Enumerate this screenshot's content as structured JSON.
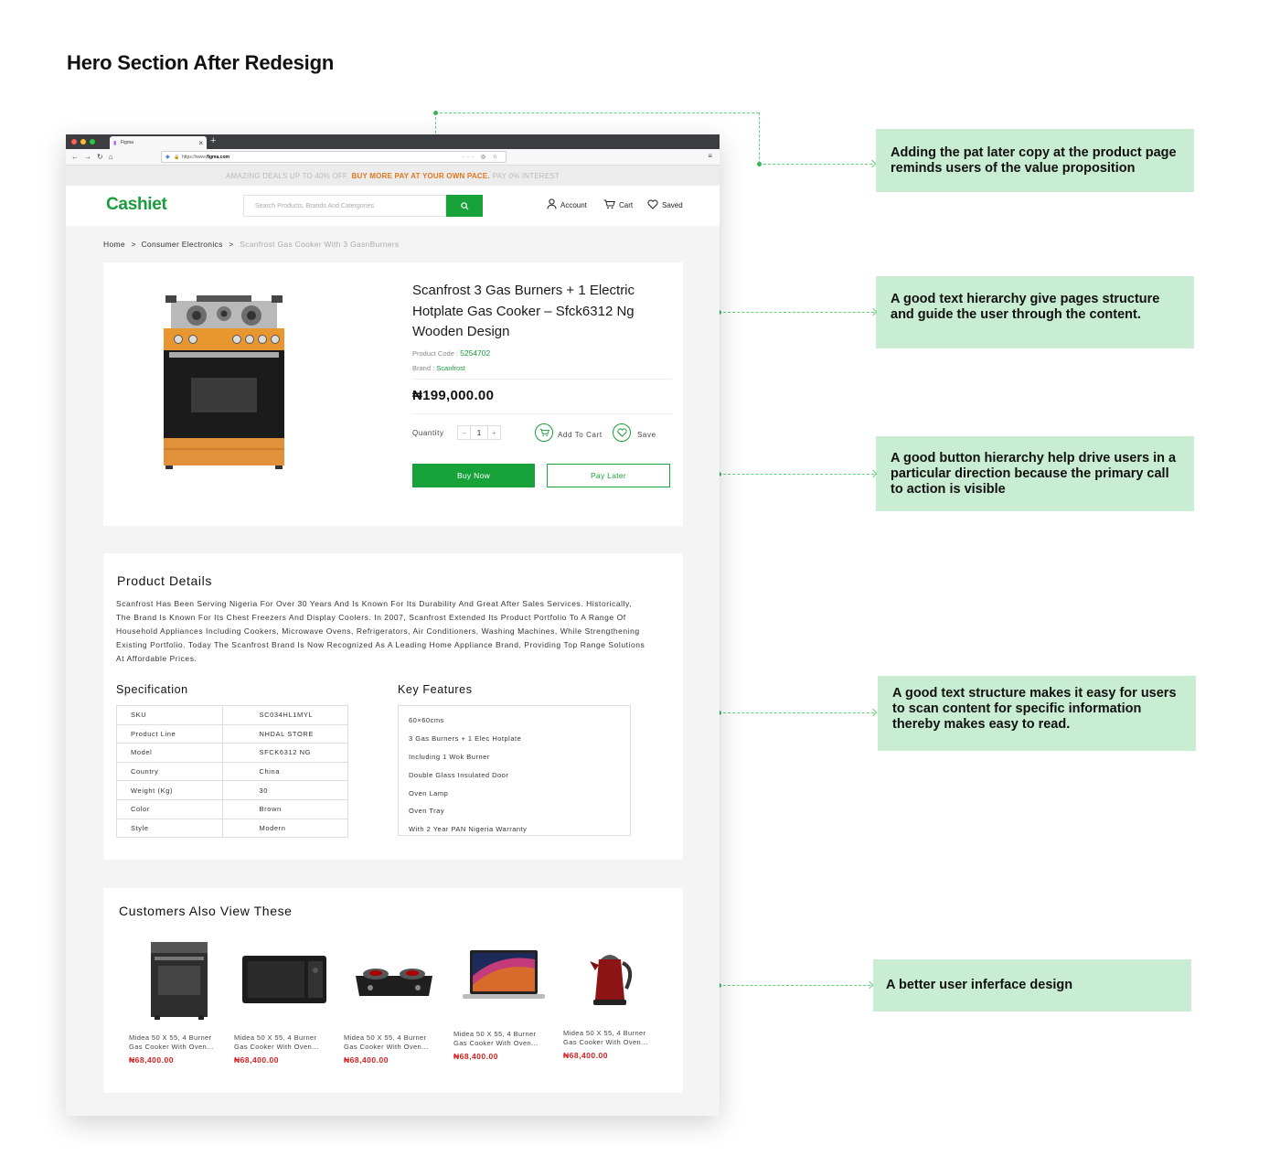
{
  "page_title": "Hero Section After Redesign",
  "annotations": [
    "Adding the pat later copy at the product page reminds users of the value proposition",
    "A good text hierarchy give pages structure and guide the user through the content.",
    "A good button hierarchy help drive users in a particular direction because the primary call to action is visible",
    "A good text structure makes it easy for users to scan content for specific information thereby makes easy to read.",
    "A better user inferface design"
  ],
  "browser": {
    "tab_title": "Figma",
    "url_prefix": "https://www.",
    "url_domain": "figma.com"
  },
  "promo": {
    "left": "AMAZING DEALS UP TO 40% OFF.",
    "middle": "BUY MORE PAY AT YOUR OWN PACE.",
    "right": "PAY 0% INTEREST",
    "accent_color": "#e0781d"
  },
  "header": {
    "logo": "Cashiet",
    "search_placeholder": "Search Products, Brands And Catergories",
    "account": "Account",
    "cart": "Cart",
    "saved": "Saved",
    "brand_color": "#17a33a"
  },
  "breadcrumb": {
    "home": "Home",
    "category": "Consumer Electronics",
    "current": "Scanfrost Gas Cooker With 3 GasnBurners",
    "sep": ">"
  },
  "product": {
    "title": "Scanfrost 3 Gas Burners + 1 Electric Hotplate Gas Cooker – Sfck6312 Ng Wooden Design",
    "code_label": "Product Code :",
    "code": "5254702",
    "brand_label": "Brand :",
    "brand": "Scanfrost",
    "price": "₦199,000.00",
    "quantity_label": "Quantity",
    "quantity": "1",
    "minus": "–",
    "plus": "+",
    "add_to_cart": "Add To Cart",
    "save": "Save",
    "buy_now": "Buy Now",
    "pay_later": "Pay Later"
  },
  "details": {
    "heading": "Product Details",
    "description": "Scanfrost Has Been Serving Nigeria For Over 30 Years And Is Known For Its Durability And Great After Sales Services. Historically, The Brand Is Known For Its Chest Freezers And Display Coolers. In 2007, Scanfrost Extended Its Product Portfolio To A Range Of Household Appliances Including Cookers, Microwave Ovens, Refrigerators, Air Conditioners, Washing Machines, While Strengthening Existing Portfolio. Today The Scanfrost Brand Is Now Recognized As A Leading Home Appliance Brand, Providing Top Range Solutions At Affordable Prices.",
    "spec_heading": "Specification",
    "specs": [
      {
        "k": "SKU",
        "v": "SC034HL1MYL"
      },
      {
        "k": "Product Line",
        "v": "NHDAL STORE"
      },
      {
        "k": "Model",
        "v": "SFCK6312 NG"
      },
      {
        "k": "Country",
        "v": "China"
      },
      {
        "k": "Weight (Kg)",
        "v": "30"
      },
      {
        "k": "Color",
        "v": "Brown"
      },
      {
        "k": "Style",
        "v": "Modern"
      }
    ],
    "features_heading": "Key Features",
    "features": [
      "60×60cms",
      "3 Gas Burners + 1 Elec Hotplate",
      "Including 1 Wok Burner",
      "Double Glass Insulated Door",
      "Oven Lamp",
      "Oven Tray",
      "With 2 Year PAN Nigeria Warranty"
    ]
  },
  "also_view": {
    "heading": "Customers Also View These",
    "items": [
      {
        "line1": "Midea 50 X 55, 4 Burner",
        "line2": "Gas Cooker With Oven...",
        "price": "₦68,400.00",
        "icon": "cooker-icon"
      },
      {
        "line1": "Midea 50 X 55, 4 Burner",
        "line2": "Gas Cooker With Oven...",
        "price": "₦68,400.00",
        "icon": "microwave-icon"
      },
      {
        "line1": "Midea 50 X 55, 4 Burner",
        "line2": "Gas Cooker With Oven...",
        "price": "₦68,400.00",
        "icon": "gas-stove-icon"
      },
      {
        "line1": "Midea 50 X 55, 4 Burner",
        "line2": "Gas Cooker With Oven...",
        "price": "₦68,400.00",
        "icon": "laptop-icon"
      },
      {
        "line1": "Midea 50 X 55, 4 Burner",
        "line2": "Gas Cooker With Oven...",
        "price": "₦68,400.00",
        "icon": "kettle-icon"
      }
    ],
    "price_color": "#d61e1e"
  }
}
